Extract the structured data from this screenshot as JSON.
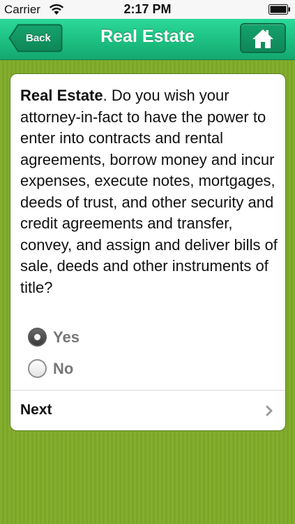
{
  "status_bar": {
    "carrier": "Carrier",
    "time": "2:17 PM",
    "wifi_icon": "wifi-icon",
    "battery_icon": "battery-icon"
  },
  "nav": {
    "back_label": "Back",
    "title": "Real Estate",
    "home_icon": "home-icon"
  },
  "question": {
    "heading": "Real Estate",
    "body": ". Do you wish your attorney-in-fact to have the power to enter into contracts and rental agreements, borrow money and incur expenses, execute notes, mortgages, deeds of trust, and other security and credit agreements and transfer, convey, and assign and deliver bills of sale, deeds and other instruments of title?"
  },
  "options": [
    {
      "label": "Yes",
      "selected": true
    },
    {
      "label": "No",
      "selected": false
    }
  ],
  "next": {
    "label": "Next",
    "icon": "chevron-right-icon"
  },
  "colors": {
    "nav_green": "#1ec182",
    "background_green": "#7fab2c"
  }
}
